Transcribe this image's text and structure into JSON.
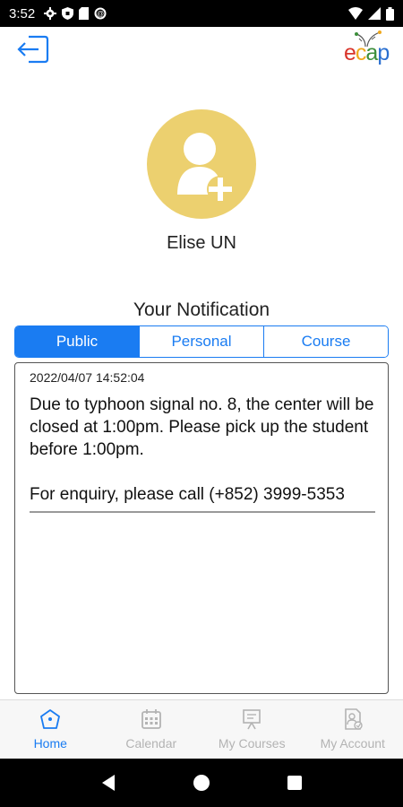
{
  "status_bar": {
    "time": "3:52"
  },
  "header": {
    "logo": {
      "letters": [
        "e",
        "c",
        "a",
        "p"
      ]
    }
  },
  "profile": {
    "name": "Elise UN",
    "avatar_color": "#ecd06f"
  },
  "notifications": {
    "title": "Your Notification",
    "tabs": [
      {
        "label": "Public",
        "active": true
      },
      {
        "label": "Personal",
        "active": false
      },
      {
        "label": "Course",
        "active": false
      }
    ],
    "items": [
      {
        "timestamp": "2022/04/07 14:52:04",
        "message": "Due to typhoon signal no. 8, the center will be closed at 1:00pm. Please pick up the student before 1:00pm.\n\nFor enquiry, please call (+852) 3999-5353"
      }
    ]
  },
  "bottom_nav": {
    "items": [
      {
        "label": "Home",
        "icon": "home-icon",
        "active": true
      },
      {
        "label": "Calendar",
        "icon": "calendar-icon",
        "active": false
      },
      {
        "label": "My Courses",
        "icon": "courses-icon",
        "active": false
      },
      {
        "label": "My Account",
        "icon": "account-icon",
        "active": false
      }
    ]
  },
  "colors": {
    "accent": "#1a7cf2",
    "inactive": "#b3b3b3"
  }
}
